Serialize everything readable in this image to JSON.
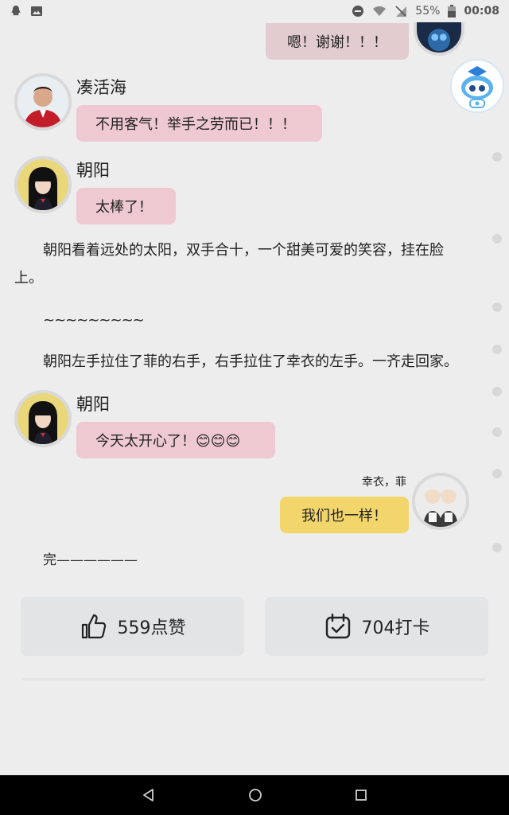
{
  "status": {
    "battery": "55%",
    "time": "00:08"
  },
  "messages": {
    "m1_text": "嗯！谢谢！！！",
    "m2_name": "凑活海",
    "m2_text": "不用客气！举手之劳而已！！！",
    "m3_name": "朝阳",
    "m3_text": "太棒了！",
    "m4_name": "朝阳",
    "m4_text": "今天太开心了！😊😊😊",
    "m5_name": "幸衣，菲",
    "m5_text": "我们也一样！"
  },
  "narration": {
    "p1_line1": "朝阳看着远处的太阳，双手合十，一个甜美可爱的笑容，挂在脸",
    "p1_line2": "上。",
    "p2": "~~~~~~~~~",
    "p3": "朝阳左手拉住了菲的右手，右手拉住了幸衣的左手。一齐走回家。",
    "end": "完——————"
  },
  "actions": {
    "like_label": "559点赞",
    "checkin_label": "704打卡"
  },
  "colors": {
    "pink_bubble": "#efc9d2",
    "yellow_bubble": "#f2d66b",
    "button_bg": "#e2e4e6"
  }
}
